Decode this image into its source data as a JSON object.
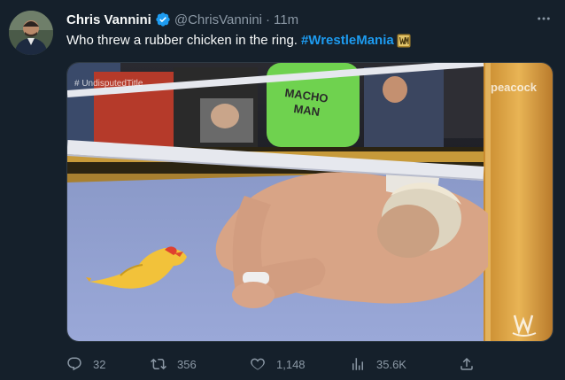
{
  "tweet": {
    "author": {
      "display_name": "Chris Vannini",
      "handle": "@ChrisVannini",
      "verified": true,
      "avatar_icon": "profile-photo"
    },
    "time": "11m",
    "separator": "·",
    "text": "Who threw a rubber chicken in the ring.",
    "hashtag": "#WrestleMania",
    "more_icon": "ellipsis-icon",
    "media": {
      "watermark_top_left": "# UndisputedTitle",
      "watermark_top_right": "peacock",
      "watermark_bottom_right": "W",
      "shirt_text": "MACHO MAN"
    },
    "actions": {
      "replies": "32",
      "retweets": "356",
      "likes": "1,148",
      "views": "35.6K"
    }
  },
  "colors": {
    "background": "#15202b",
    "text": "#f7f9f9",
    "secondary": "#8b98a5",
    "accent": "#1d9bf0"
  }
}
